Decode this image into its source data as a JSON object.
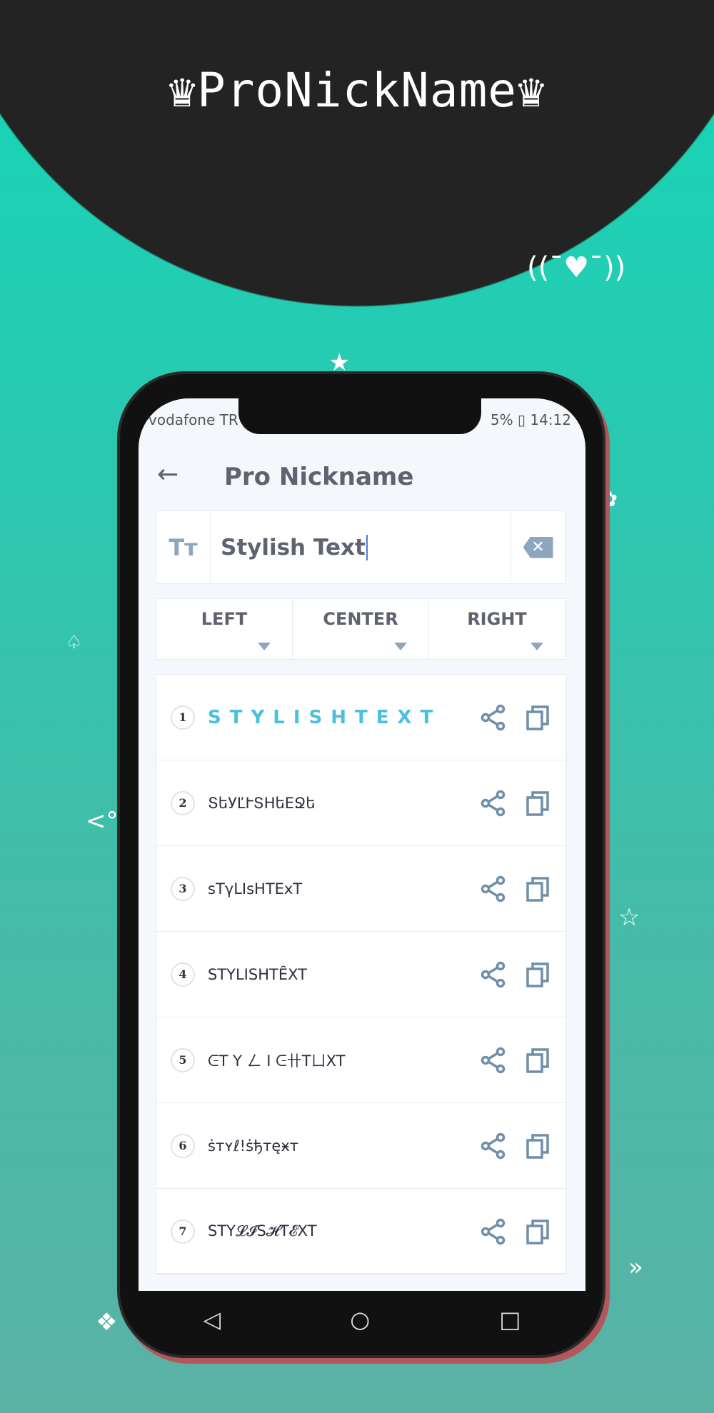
{
  "banner": {
    "title": "♛ProNickName♛",
    "kaomoji": "((¯♥¯))"
  },
  "status": {
    "carrier": "vodafone TR",
    "battery": "5%",
    "time": "14:12"
  },
  "app": {
    "title": "Pro Nickname",
    "back_icon": "arrow-left-icon"
  },
  "input": {
    "value": "Stylish Text",
    "icon_text": "Tт"
  },
  "alignment": [
    {
      "label": "LEFT"
    },
    {
      "label": "CENTER"
    },
    {
      "label": "RIGHT"
    }
  ],
  "results": [
    {
      "num": "1",
      "text": "STYLISHTEXT"
    },
    {
      "num": "2",
      "text": "ՏեУĽՒՏНեЕՋե"
    },
    {
      "num": "3",
      "text": "sTγLIsHTExT"
    },
    {
      "num": "4",
      "text": "ЅTҮLIЅHTȆXT"
    },
    {
      "num": "5",
      "text": "ᕮT Y ㄥ I ᕮ卄TㄩXT"
    },
    {
      "num": "6",
      "text": "ṡтʏℓ!ṡђтęӿт"
    },
    {
      "num": "7",
      "text": "STY𝓛𝓘S𝓗T𝓔XT"
    }
  ],
  "colors": {
    "accent": "#4bbfe0",
    "icon": "#6f8ea8",
    "background": "#14d6b6"
  }
}
